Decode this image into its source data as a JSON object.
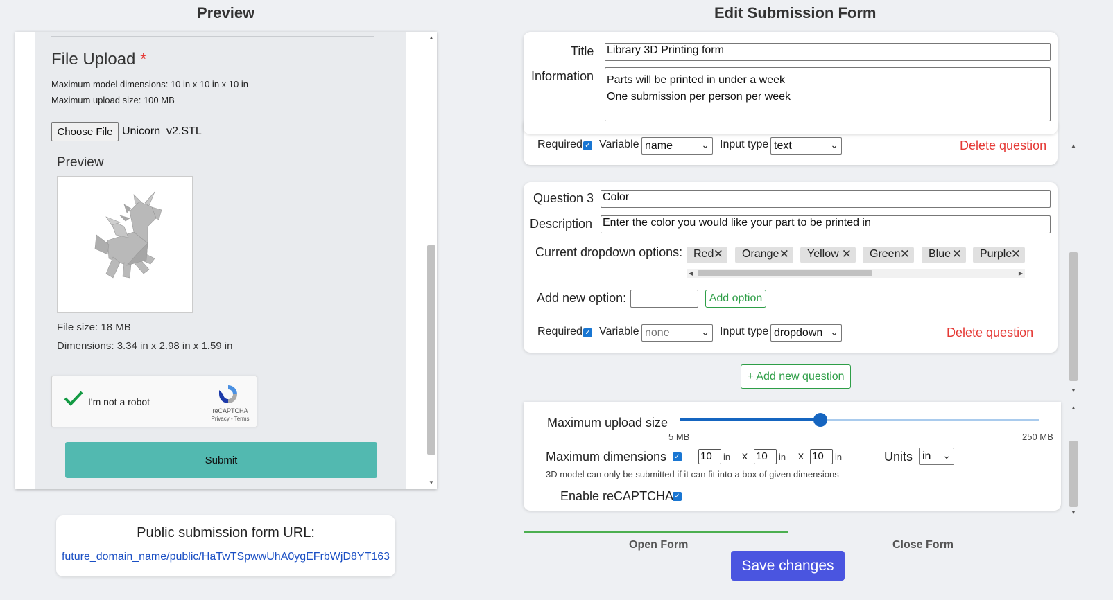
{
  "preview": {
    "heading": "Preview",
    "file_upload_title": "File Upload",
    "required_mark": "*",
    "max_dimensions_text": "Maximum model dimensions: 10 in x 10 in x 10 in",
    "max_upload_text": "Maximum upload size: 100 MB",
    "choose_file_label": "Choose File",
    "file_name": "Unicorn_v2.STL",
    "model_preview_label": "Preview",
    "file_size_text": "File size: 18 MB",
    "dimensions_text": "Dimensions: 3.34 in x 2.98 in x 1.59 in",
    "recaptcha": {
      "label": "I'm not a robot",
      "brand": "reCAPTCHA",
      "links": "Privacy - Terms"
    },
    "submit_label": "Submit",
    "scroll_position": 0.45
  },
  "public_url": {
    "label": "Public submission form URL:",
    "url": "future_domain_name/public/HaTwTSpwwUhA0ygEFrbWjD8YT163"
  },
  "editor": {
    "heading": "Edit Submission Form",
    "title_label": "Title",
    "title_value": "Library 3D Printing form",
    "information_label": "Information",
    "information_lines": [
      "Parts will be printed in under a week",
      "One submission per person per week"
    ],
    "question2": {
      "required_label": "Required",
      "required": true,
      "variable_label": "Variable",
      "variable_value": "name",
      "input_type_label": "Input type",
      "input_type_value": "text",
      "delete_label": "Delete question"
    },
    "question3": {
      "label": "Question 3",
      "value": "Color",
      "description_label": "Description",
      "description_value": "Enter the color you would like your part to be printed in",
      "options_label": "Current dropdown options:",
      "options": [
        "Red",
        "Orange",
        "Yellow",
        "Green",
        "Blue",
        "Purple"
      ],
      "add_option_label": "Add new option:",
      "add_option_input": "",
      "add_option_button": "Add option",
      "required_label": "Required",
      "required": true,
      "variable_label": "Variable",
      "variable_value": "none",
      "input_type_label": "Input type",
      "input_type_value": "dropdown",
      "delete_label": "Delete question"
    },
    "add_question_label": "+ Add new question",
    "settings": {
      "max_upload_label": "Maximum upload size",
      "slider_min_label": "5 MB",
      "slider_max_label": "250 MB",
      "slider_value_fraction": 0.39,
      "max_dimensions_label": "Maximum dimensions",
      "max_dimensions_enabled": true,
      "dim_x": "10",
      "dim_y": "10",
      "dim_z": "10",
      "dim_unit": "in",
      "times": "x",
      "units_label": "Units",
      "units_value": "in",
      "dimensions_hint": "3D model can only be submitted if it can fit into a box of given dimensions",
      "recaptcha_label": "Enable reCAPTCHA",
      "recaptcha_enabled": true
    },
    "tabs": {
      "open": "Open Form",
      "close": "Close Form",
      "active": "open"
    },
    "save_label": "Save changes"
  },
  "colors": {
    "accent_blue": "#1565c0",
    "submit_teal": "#52b9b0",
    "save_indigo": "#4a55e0",
    "delete_red": "#e53935",
    "add_green": "#2e9e47",
    "link_blue": "#1a4fc4",
    "recaptcha_check": "#139a43"
  }
}
